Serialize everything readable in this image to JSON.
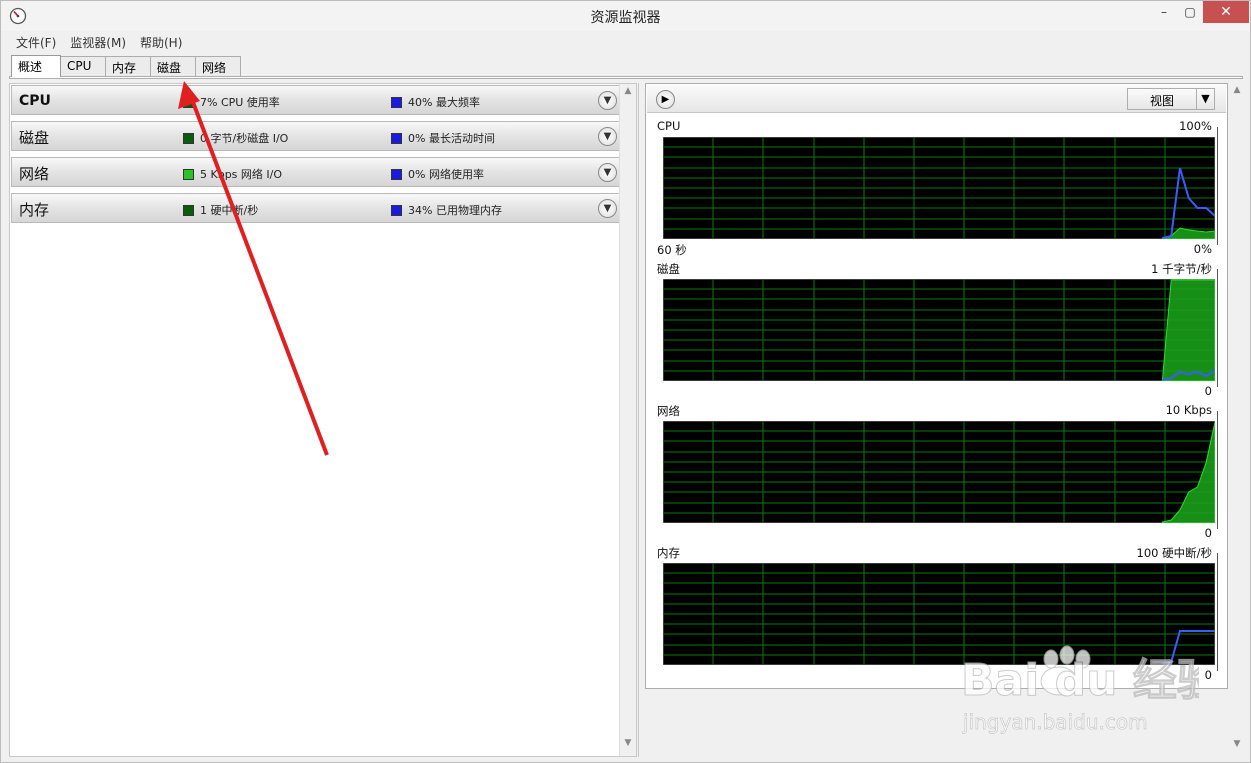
{
  "window": {
    "title": "资源监视器",
    "min": "–",
    "max": "▢",
    "close": "✕"
  },
  "menu": [
    "文件(F)",
    "监视器(M)",
    "帮助(H)"
  ],
  "tabs": [
    "概述",
    "CPU",
    "内存",
    "磁盘",
    "网络"
  ],
  "sections": [
    {
      "title": "CPU",
      "legend1": "7% CPU 使用率",
      "legend2": "40% 最大频率",
      "sw1": "dgreen"
    },
    {
      "title": "磁盘",
      "legend1": "0 字节/秒磁盘 I/O",
      "legend2": "0% 最长活动时间",
      "sw1": "dgreen"
    },
    {
      "title": "网络",
      "legend1": "5 Kbps 网络 I/O",
      "legend2": "0% 网络使用率",
      "sw1": "lgreen"
    },
    {
      "title": "内存",
      "legend1": "1 硬中断/秒",
      "legend2": "34% 已用物理内存",
      "sw1": "dgreen"
    }
  ],
  "graph_panel": {
    "view_label": "视图",
    "graphs": [
      {
        "name": "CPU",
        "max": "100%",
        "min": "0%",
        "time": "60 秒",
        "series_green": [
          0,
          0,
          0,
          0,
          0,
          0,
          0,
          0,
          0,
          0,
          0,
          0,
          0,
          0,
          0,
          0,
          0,
          0,
          0,
          0,
          0,
          0,
          0,
          0,
          0,
          0,
          0,
          0,
          0,
          0,
          0,
          0,
          0,
          0,
          0,
          0,
          0,
          0,
          0,
          0,
          0,
          0,
          0,
          0,
          0,
          0,
          0,
          0,
          0,
          0,
          0,
          0,
          0,
          0,
          0,
          0,
          0,
          0,
          2,
          10,
          8,
          7,
          6,
          7
        ],
        "series_blue": [
          0,
          0,
          0,
          0,
          0,
          0,
          0,
          0,
          0,
          0,
          0,
          0,
          0,
          0,
          0,
          0,
          0,
          0,
          0,
          0,
          0,
          0,
          0,
          0,
          0,
          0,
          0,
          0,
          0,
          0,
          0,
          0,
          0,
          0,
          0,
          0,
          0,
          0,
          0,
          0,
          0,
          0,
          0,
          0,
          0,
          0,
          0,
          0,
          0,
          0,
          0,
          0,
          0,
          0,
          0,
          0,
          0,
          0,
          2,
          70,
          40,
          30,
          30,
          22
        ]
      },
      {
        "name": "磁盘",
        "max": "1 千字节/秒",
        "min": "0",
        "series_green": [
          0,
          0,
          0,
          0,
          0,
          0,
          0,
          0,
          0,
          0,
          0,
          0,
          0,
          0,
          0,
          0,
          0,
          0,
          0,
          0,
          0,
          0,
          0,
          0,
          0,
          0,
          0,
          0,
          0,
          0,
          0,
          0,
          0,
          0,
          0,
          0,
          0,
          0,
          0,
          0,
          0,
          0,
          0,
          0,
          0,
          0,
          0,
          0,
          0,
          0,
          0,
          0,
          0,
          0,
          0,
          0,
          0,
          0,
          100,
          100,
          100,
          100,
          100,
          100
        ],
        "series_blue": [
          0,
          0,
          0,
          0,
          0,
          0,
          0,
          0,
          0,
          0,
          0,
          0,
          0,
          0,
          0,
          0,
          0,
          0,
          0,
          0,
          0,
          0,
          0,
          0,
          0,
          0,
          0,
          0,
          0,
          0,
          0,
          0,
          0,
          0,
          0,
          0,
          0,
          0,
          0,
          0,
          0,
          0,
          0,
          0,
          0,
          0,
          0,
          0,
          0,
          0,
          0,
          0,
          0,
          0,
          0,
          0,
          0,
          0,
          2,
          8,
          6,
          8,
          4,
          10
        ]
      },
      {
        "name": "网络",
        "max": "10 Kbps",
        "min": "0",
        "series_green": [
          0,
          0,
          0,
          0,
          0,
          0,
          0,
          0,
          0,
          0,
          0,
          0,
          0,
          0,
          0,
          0,
          0,
          0,
          0,
          0,
          0,
          0,
          0,
          0,
          0,
          0,
          0,
          0,
          0,
          0,
          0,
          0,
          0,
          0,
          0,
          0,
          0,
          0,
          0,
          0,
          0,
          0,
          0,
          0,
          0,
          0,
          0,
          0,
          0,
          0,
          0,
          0,
          0,
          0,
          0,
          0,
          0,
          0,
          2,
          12,
          30,
          35,
          60,
          100
        ],
        "series_blue": []
      },
      {
        "name": "内存",
        "max": "100 硬中断/秒",
        "min": "0",
        "series_green": [],
        "series_blue": [
          0,
          0,
          0,
          0,
          0,
          0,
          0,
          0,
          0,
          0,
          0,
          0,
          0,
          0,
          0,
          0,
          0,
          0,
          0,
          0,
          0,
          0,
          0,
          0,
          0,
          0,
          0,
          0,
          0,
          0,
          0,
          0,
          0,
          0,
          0,
          0,
          0,
          0,
          0,
          0,
          0,
          0,
          0,
          0,
          0,
          0,
          0,
          0,
          0,
          0,
          0,
          0,
          0,
          0,
          0,
          0,
          0,
          0,
          2,
          33,
          33,
          33,
          33,
          33
        ]
      }
    ]
  }
}
